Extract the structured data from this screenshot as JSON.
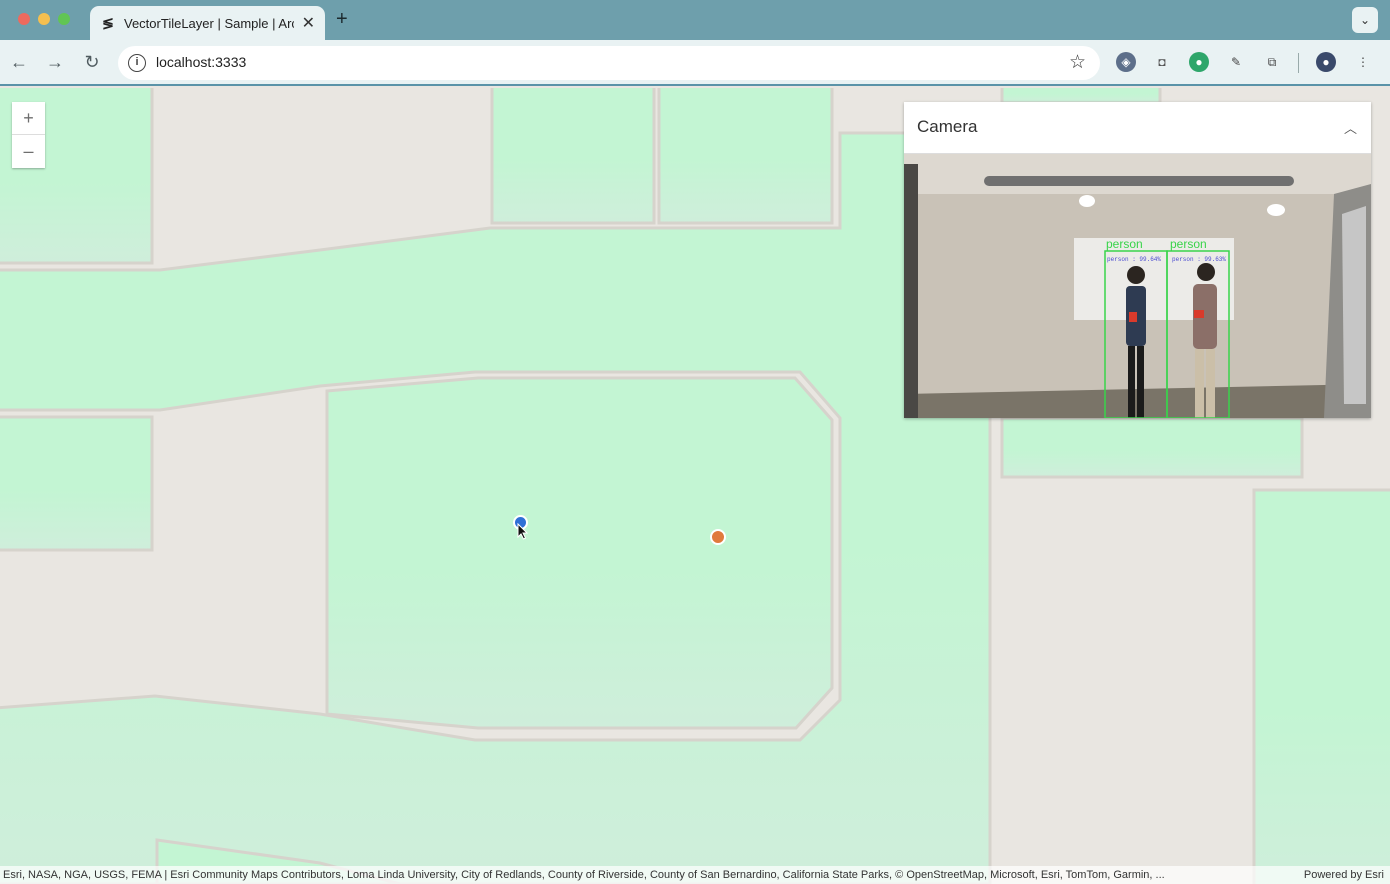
{
  "browser": {
    "tab_title": "VectorTileLayer | Sample | ArcGIS",
    "url": "localhost:3333",
    "new_tab": "+",
    "tab_close": "✕"
  },
  "map": {
    "zoom_in": "+",
    "zoom_out": "–",
    "camera_panel": {
      "title": "Camera",
      "detections": [
        {
          "label": "person",
          "score_text": "person : 99.64%"
        },
        {
          "label": "person",
          "score_text": "person : 99.63%"
        }
      ]
    },
    "attribution": "Esri, NASA, NGA, USGS, FEMA | Esri Community Maps Contributors, Loma Linda University, City of Redlands, County of Riverside, County of San Bernardino, California State Parks, © OpenStreetMap, Microsoft, Esri, TomTom, Garmin, ...",
    "powered_by": "Powered by Esri",
    "markers": [
      {
        "name": "blue-point",
        "color": "#2f6fd6"
      },
      {
        "name": "orange-point",
        "color": "#e07a3c"
      }
    ]
  },
  "colors": {
    "land": "#c3f5d3",
    "road": "#e9e6e1",
    "chrome": "#6e9fac",
    "toolbar": "#e9f2f3"
  }
}
